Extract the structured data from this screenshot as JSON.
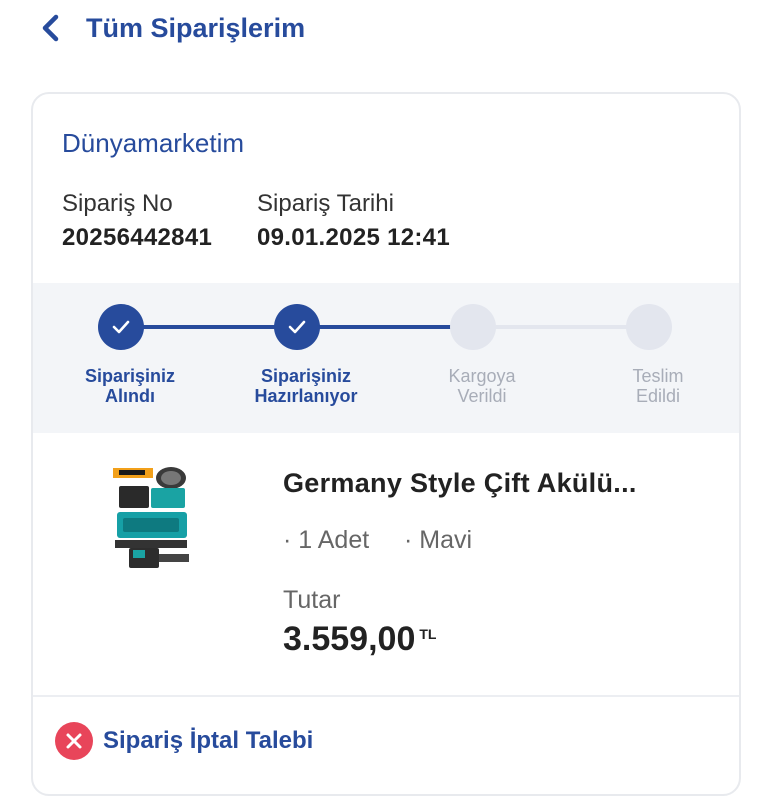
{
  "header": {
    "title": "Tüm Siparişlerim"
  },
  "order": {
    "store": "Dünyamarketim",
    "number_label": "Sipariş No",
    "number": "20256442841",
    "date_label": "Sipariş Tarihi",
    "date": "09.01.2025 12:41"
  },
  "progress": {
    "steps": [
      {
        "line1": "Siparişiniz",
        "line2": "Alındı",
        "status": "done"
      },
      {
        "line1": "Siparişiniz",
        "line2": "Hazırlanıyor",
        "status": "done"
      },
      {
        "line1": "Kargoya",
        "line2": "Verildi",
        "status": "todo"
      },
      {
        "line1": "Teslim",
        "line2": "Edildi",
        "status": "todo"
      }
    ],
    "completed_steps": 2,
    "active_color": "#274b9c",
    "inactive_color": "#e3e6ee"
  },
  "product": {
    "title": "Germany Style Çift Akülü...",
    "quantity": "· 1 Adet",
    "color": "· Mavi",
    "total_label": "Tutar",
    "price": "3.559,00",
    "currency": "TL"
  },
  "actions": {
    "cancel_label": "Sipariş İptal Talebi"
  },
  "colors": {
    "brand": "#274b9c",
    "danger": "#e8455a"
  }
}
